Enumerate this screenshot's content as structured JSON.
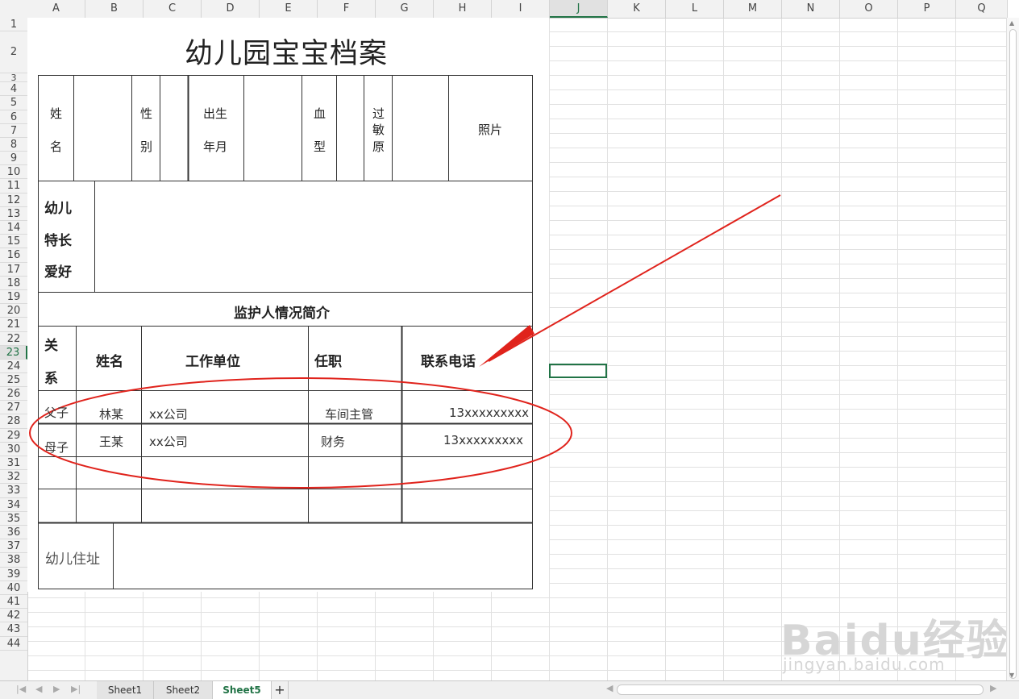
{
  "columns": [
    "A",
    "B",
    "C",
    "D",
    "E",
    "F",
    "G",
    "H",
    "I",
    "J",
    "K",
    "L",
    "M",
    "N",
    "O",
    "P",
    "Q"
  ],
  "selected_column": "J",
  "rows": [
    "1",
    "2",
    "3",
    "4",
    "5",
    "6",
    "7",
    "8",
    "9",
    "10",
    "11",
    "12",
    "13",
    "14",
    "15",
    "16",
    "17",
    "18",
    "19",
    "20",
    "21",
    "22",
    "23",
    "24",
    "25",
    "26",
    "27",
    "28",
    "29",
    "30",
    "31",
    "32",
    "33",
    "34",
    "35",
    "36",
    "37",
    "38",
    "39",
    "40",
    "41",
    "42",
    "43",
    "44"
  ],
  "selected_row": "23",
  "document": {
    "title": "幼儿园宝宝档案",
    "header_labels": {
      "name_1": "姓",
      "name_2": "名",
      "gender_1": "性",
      "gender_2": "别",
      "birth_1": "出生",
      "birth_2": "年月",
      "blood_1": "血",
      "blood_2": "型",
      "allergy_1": "过",
      "allergy_2": "敏",
      "allergy_3": "原",
      "photo": "照片"
    },
    "hobby_label": [
      "幼儿",
      "特长",
      "爱好"
    ],
    "guardian_section": "监护人情况简介",
    "guardian_headers": {
      "relation_1": "关",
      "relation_2": "系",
      "name": "姓名",
      "workplace": "工作单位",
      "position": "任职",
      "phone": "联系电话"
    },
    "guardians": [
      {
        "relation": "父子",
        "name": "林某",
        "workplace": "xx公司",
        "position": "车间主管",
        "phone": "13xxxxxxxxx"
      },
      {
        "relation": "母子",
        "name": "王某",
        "workplace": "xx公司",
        "position": "财务",
        "phone": "13xxxxxxxxx"
      }
    ],
    "address_label": "幼儿住址"
  },
  "annotation_color": "#e0231c",
  "sheet_tabs": [
    "Sheet1",
    "Sheet2",
    "Sheet5"
  ],
  "active_tab": "Sheet5",
  "add_sheet_label": "+",
  "watermark": {
    "brand": "Baidu经验",
    "url": "jingyan.baidu.com"
  }
}
